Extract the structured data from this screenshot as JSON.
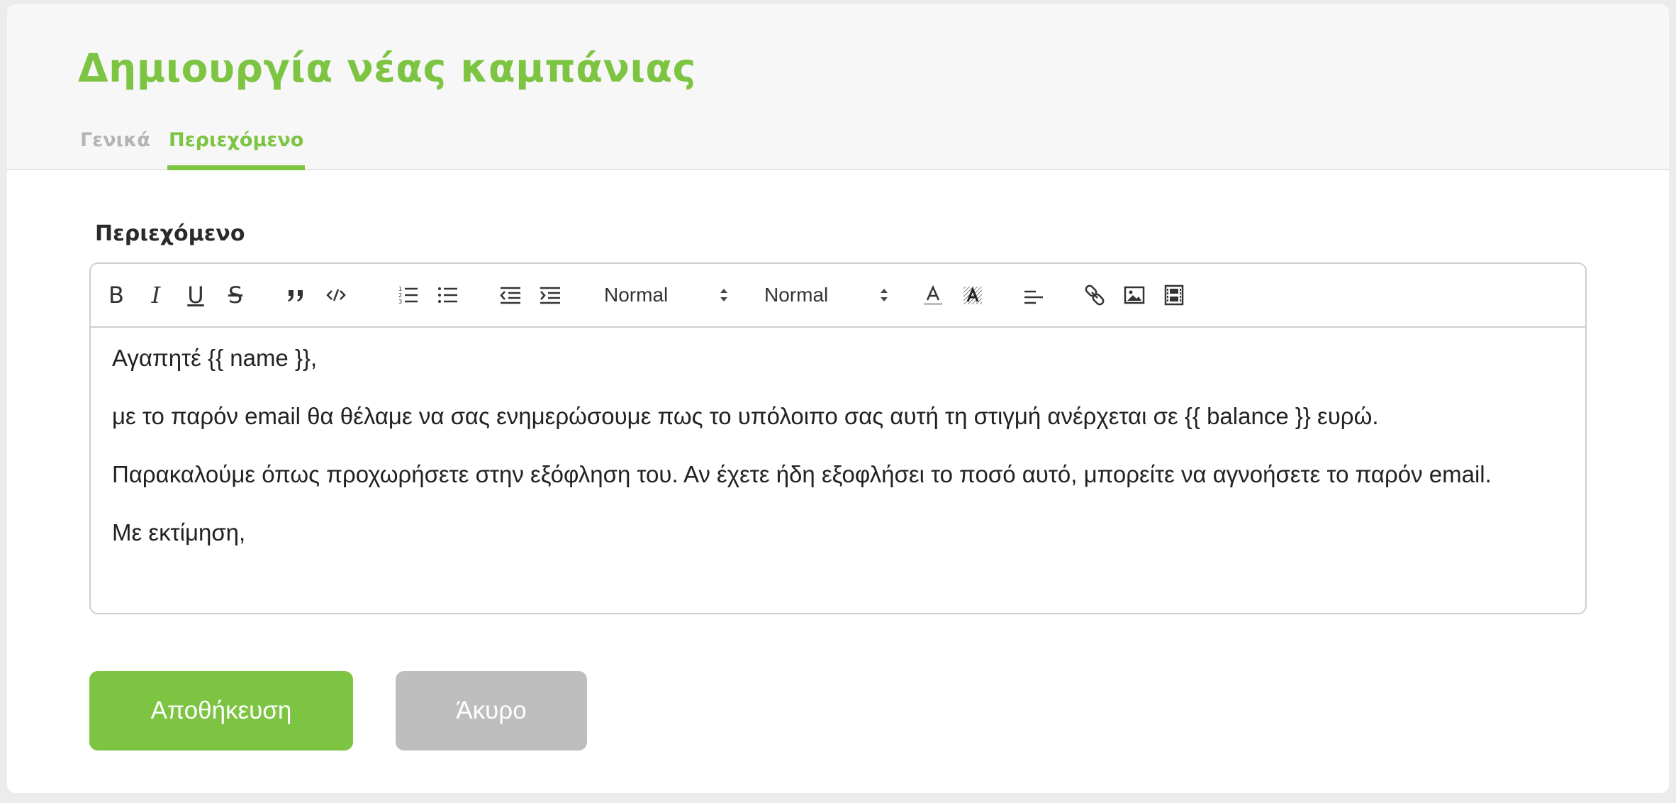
{
  "page": {
    "title": "Δημιουργία νέας καμπάνιας"
  },
  "tabs": [
    {
      "label": "Γενικά",
      "active": false
    },
    {
      "label": "Περιεχόμενο",
      "active": true
    }
  ],
  "form": {
    "content_label": "Περιεχόμενο"
  },
  "toolbar": {
    "buttons": [
      {
        "icon": "bold-icon",
        "glyph": "B"
      },
      {
        "icon": "italic-icon",
        "glyph": "I"
      },
      {
        "icon": "underline-icon",
        "glyph": "U"
      },
      {
        "icon": "strikethrough-icon",
        "glyph": "S"
      },
      {
        "icon": "blockquote-icon"
      },
      {
        "icon": "code-block-icon"
      },
      {
        "icon": "ordered-list-icon"
      },
      {
        "icon": "bullet-list-icon"
      },
      {
        "icon": "outdent-icon"
      },
      {
        "icon": "indent-icon"
      },
      {
        "icon": "text-color-icon"
      },
      {
        "icon": "background-color-icon"
      },
      {
        "icon": "align-icon"
      },
      {
        "icon": "link-icon"
      },
      {
        "icon": "image-icon"
      },
      {
        "icon": "video-icon"
      }
    ],
    "header_select": "Normal",
    "size_select": "Normal"
  },
  "editor": {
    "paragraphs": [
      "Αγαπητέ {{ name }},",
      "με το παρόν email θα θέλαμε να σας ενημερώσουμε πως το υπόλοιπο σας αυτή τη στιγμή ανέρχεται σε {{ balance }} ευρώ.",
      "Παρακαλούμε όπως προχωρήσετε στην εξόφληση του. Αν έχετε ήδη εξοφλήσει το ποσό αυτό, μπορείτε να αγνοήσετε το παρόν email.",
      "Με εκτίμηση,"
    ]
  },
  "actions": {
    "save_label": "Αποθήκευση",
    "cancel_label": "Άκυρο"
  },
  "colors": {
    "accent": "#7dc443",
    "muted_tab": "#b4b4b4",
    "cancel_bg": "#bebebe"
  }
}
